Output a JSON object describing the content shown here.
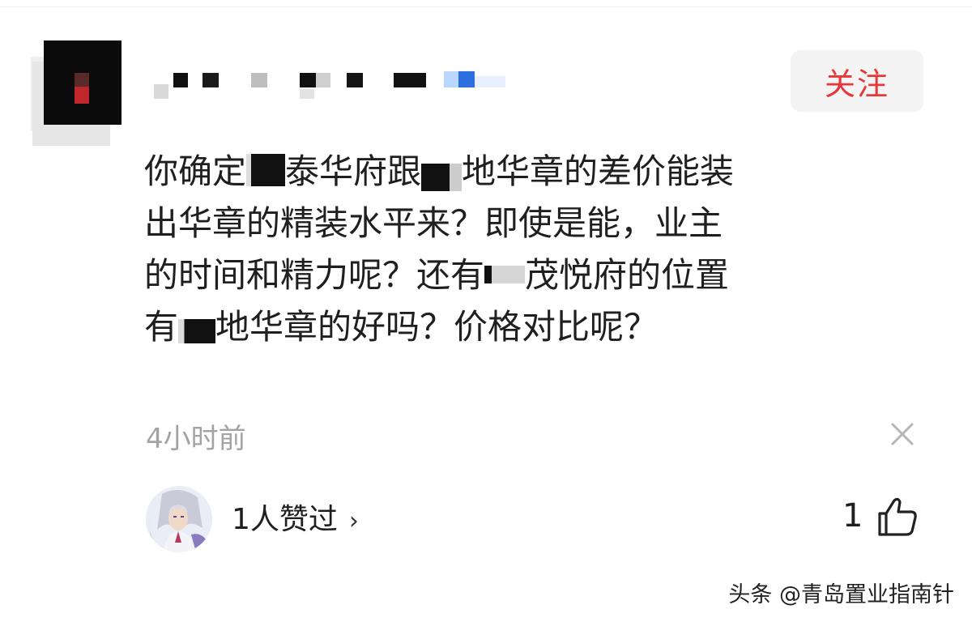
{
  "header": {
    "follow_label": "关注"
  },
  "comment": {
    "lines": [
      [
        "你确定",
        "泰华府跟",
        "地华章的差价能装"
      ],
      [
        "出华章的精装水平来？即使是能，业主"
      ],
      [
        "的时间和精力呢？还有",
        "茂悦府的位置"
      ],
      [
        "有",
        "地华章的好吗？价格对比呢？"
      ]
    ],
    "timestamp": "4小时前"
  },
  "footer": {
    "likers_text": "1人赞过",
    "likers_chevron": "›",
    "like_count": "1"
  },
  "watermark": "头条 @青岛置业指南针",
  "colors": {
    "follow_text": "#e8373a",
    "follow_bg": "#f4f4f4",
    "timestamp": "#a3a3a3",
    "text": "#1f1f1f"
  },
  "icons": {
    "dismiss": "close-icon",
    "like": "thumbs-up-icon",
    "avatar": "user-avatar",
    "liker_avatar": "liker-avatar"
  }
}
